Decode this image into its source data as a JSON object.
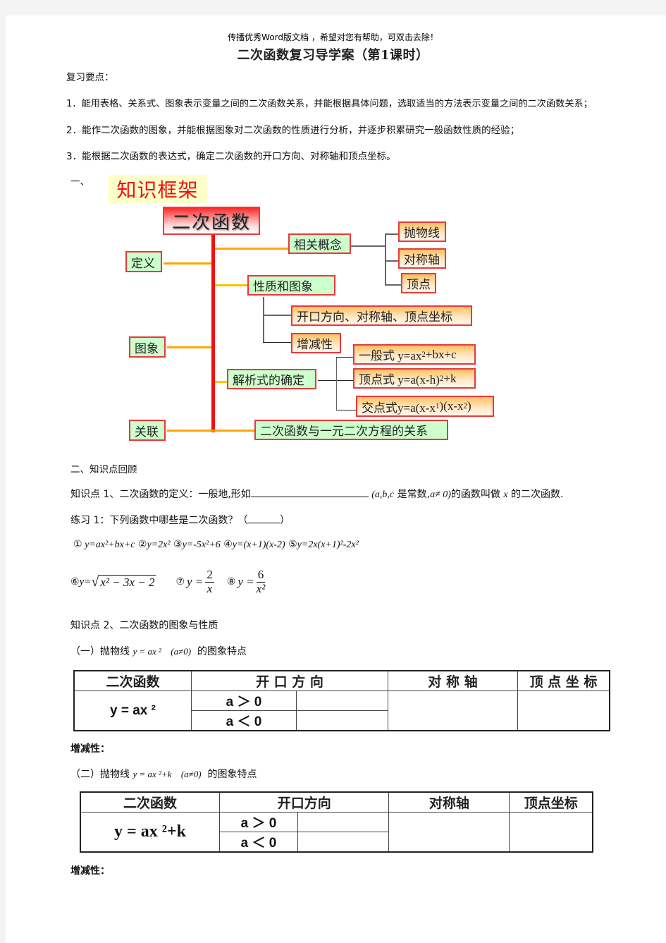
{
  "header": {
    "watermark": "传播优秀Word版文档 ，希望对您有帮助，可双击去除！",
    "title": "二次函数复习导学案（第1课时）"
  },
  "review": {
    "heading": "复习要点：",
    "points": [
      "1．能用表格、关系式、图象表示变量之间的二次函数关系，并能根据具体问题，选取适当的方法表示变量之间的二次函数关系；",
      "2．能作二次函数的图象，并能根据图象对二次函数的性质进行分析，并逐步积累研究一般函数性质的经验；",
      "3．能根据二次函数的表达式，确定二次函数的开口方向、对称轴和顶点坐标。"
    ]
  },
  "section1": {
    "label": "一、",
    "framework_title": "知识框架",
    "mindmap": {
      "root": "二次函数",
      "left": [
        "定义",
        "图象",
        "关联"
      ],
      "concepts": {
        "label": "相关概念",
        "children": [
          "抛物线",
          "对称轴",
          "顶点"
        ]
      },
      "properties": {
        "label": "性质和图象",
        "children": [
          "开口方向、对称轴、顶点坐标",
          "增减性"
        ]
      },
      "analytic": {
        "label": "解析式的确定",
        "general_prefix": "一般式 y=ax",
        "general_suffix": "+bx+c",
        "vertex_prefix": "顶点式 y=a(x-h)",
        "vertex_suffix": "+k",
        "intercept_prefix": "交点式y=a(x-x",
        "intercept_mid": ")(x-x",
        "intercept_end": ")",
        "sub1": "1",
        "sub2": "2",
        "sq": "2"
      },
      "relation": "二次函数与一元二次方程的关系"
    }
  },
  "section2": {
    "heading": "二、知识点回顾",
    "kp1": {
      "prefix": "知识点 1、二次函数的定义：一般地,形如",
      "condition": "(a,b,c",
      "mid": " 是常数,",
      "cond2": "a≠ 0)",
      "suffix1": "的函数叫做 ",
      "var": "x",
      "suffix2": " 的二次函数."
    },
    "exercise1": {
      "question_prefix": "练习 1：下列函数中哪些是二次函数？（",
      "question_suffix": "）",
      "items_line1": [
        {
          "num": "①",
          "expr": " y=ax²+bx+c"
        },
        {
          "num": "②",
          "expr": "y=2x²"
        },
        {
          "num": "③",
          "expr": "y=-5x²+6"
        },
        {
          "num": "④",
          "expr": "y=(x+1)(x-2)"
        },
        {
          "num": "⑤",
          "expr": "y=2x(x+1)²-2x²"
        }
      ],
      "item6_num": "⑥",
      "item6_lhs": "y=",
      "item6_radicand": "x² − 3x − 2",
      "item7_num": "⑦",
      "item7_lhs": "y =",
      "item7_num_val": "2",
      "item7_den": "x",
      "item8_num": "⑧",
      "item8_lhs": "y =",
      "item8_num_val": "6",
      "item8_den": "x²"
    },
    "kp2": {
      "heading": "知识点 2、二次函数的图象与性质",
      "part1_prefix": "（一）抛物线 ",
      "part1_expr": "y = ax ²",
      "part1_cond": "(a≠0)",
      "part1_suffix": " 的图象特点",
      "table1": {
        "headers": [
          "二次函数",
          "开 口 方 向",
          "对 称 轴",
          "顶 点 坐 标"
        ],
        "func": "y = ax ²",
        "rows": [
          "a ＞ 0",
          "a ＜ 0"
        ]
      },
      "inc_label1": "增减性：",
      "part2_prefix": "（二）抛物线 ",
      "part2_expr": "y = ax ²+k",
      "part2_cond": "(a≠0)",
      "part2_suffix": " 的图象特点",
      "table2": {
        "headers": [
          "二次函数",
          "开口方向",
          "对称轴",
          "顶点坐标"
        ],
        "func": "y = ax ²+k",
        "rows": [
          "a ＞ 0",
          "a ＜ 0"
        ]
      },
      "inc_label2": "增减性："
    }
  }
}
